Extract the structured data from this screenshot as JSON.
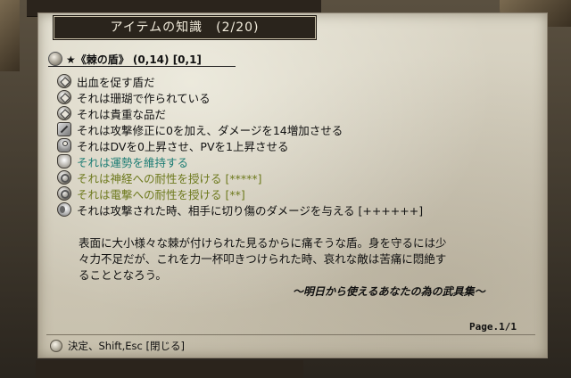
{
  "window": {
    "title": "アイテムの知識　(2/20)"
  },
  "item": {
    "header": "★《棘の盾》 (0,14) [0,1]"
  },
  "properties": [
    {
      "text": "出血を促す盾だ",
      "icon": "diamond-icon",
      "color": "#111111"
    },
    {
      "text": "それは珊瑚で作られている",
      "icon": "diamond-icon",
      "color": "#111111"
    },
    {
      "text": "それは貴重な品だ",
      "icon": "diamond-icon",
      "color": "#111111"
    },
    {
      "text": "それは攻撃修正に0を加え、ダメージを14増加させる",
      "icon": "sword-icon",
      "color": "#111111"
    },
    {
      "text": "それはDVを0上昇させ、PVを1上昇させる",
      "icon": "armor-icon",
      "color": "#111111"
    },
    {
      "text": "それは運勢を維持する",
      "icon": "bell-icon",
      "color": "#1d7d74"
    },
    {
      "text": "それは神経への耐性を授ける [*****]",
      "icon": "swirl-icon",
      "color": "#6e7a1e"
    },
    {
      "text": "それは電撃への耐性を授ける [**]",
      "icon": "swirl-icon",
      "color": "#6e7a1e"
    },
    {
      "text": "それは攻撃された時、相手に切り傷のダメージを与える [++++++]",
      "icon": "moon-icon",
      "color": "#111111"
    }
  ],
  "description": {
    "lines": [
      "表面に大小様々な棘が付けられた見るからに痛そうな盾。身を守るには少",
      "々力不足だが、これを力一杯叩きつけられた時、哀れな敵は苦痛に悶絶す",
      "ることとなろう。"
    ],
    "source": "～明日から使えるあなたの為の武具集～"
  },
  "page": {
    "label": "Page.1/1"
  },
  "footer": {
    "hint": "決定、Shift,Esc [閉じる]"
  }
}
